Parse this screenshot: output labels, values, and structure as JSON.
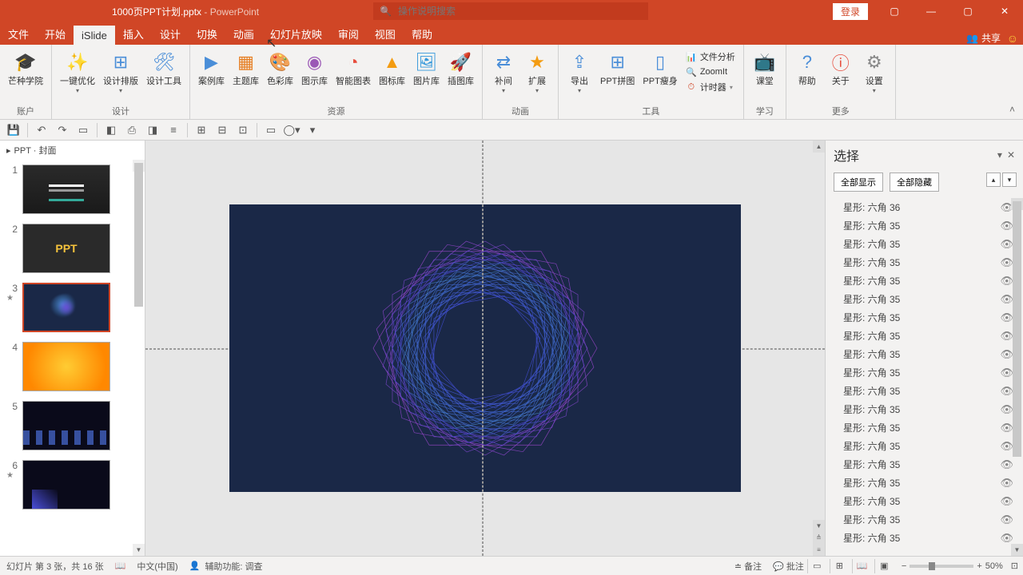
{
  "title": {
    "file": "1000页PPT计划.pptx",
    "sep": "  -  ",
    "app": "PowerPoint"
  },
  "search": {
    "placeholder": "操作说明搜索"
  },
  "login": "登录",
  "tabs": [
    "文件",
    "开始",
    "iSlide",
    "插入",
    "设计",
    "切换",
    "动画",
    "幻灯片放映",
    "审阅",
    "视图",
    "帮助"
  ],
  "active_tab": 2,
  "share": "共享",
  "ribbon": {
    "groups": [
      {
        "label": "账户",
        "items": [
          {
            "label": "芒种学院",
            "sub": "",
            "icon": "logo"
          }
        ]
      },
      {
        "label": "设计",
        "items": [
          {
            "label": "一键优化",
            "drop": true,
            "icon": "magic"
          },
          {
            "label": "设计排版",
            "drop": true,
            "icon": "layout"
          },
          {
            "label": "设计工具",
            "icon": "tools"
          }
        ]
      },
      {
        "label": "资源",
        "items": [
          {
            "label": "案例库",
            "icon": "play"
          },
          {
            "label": "主题库",
            "icon": "theme"
          },
          {
            "label": "色彩库",
            "icon": "palette"
          },
          {
            "label": "图示库",
            "icon": "diagram"
          },
          {
            "label": "智能图表",
            "icon": "pie"
          },
          {
            "label": "图标库",
            "icon": "shapes"
          },
          {
            "label": "图片库",
            "icon": "image"
          },
          {
            "label": "插图库",
            "icon": "rocket"
          }
        ]
      },
      {
        "label": "动画",
        "items": [
          {
            "label": "补间",
            "drop": true,
            "icon": "tween"
          },
          {
            "label": "扩展",
            "drop": true,
            "icon": "star"
          }
        ]
      },
      {
        "label": "工具",
        "items": [
          {
            "label": "导出",
            "drop": true,
            "icon": "export"
          },
          {
            "label": "PPT拼图",
            "icon": "grid"
          },
          {
            "label": "PPT瘦身",
            "icon": "slim"
          }
        ],
        "small": [
          {
            "label": "文件分析",
            "icon": "analysis",
            "color": "#d04626"
          },
          {
            "label": "ZoomIt",
            "icon": "zoom",
            "color": "#d04626"
          },
          {
            "label": "计时器",
            "icon": "timer",
            "drop": true,
            "color": "#d04626"
          }
        ]
      },
      {
        "label": "学习",
        "items": [
          {
            "label": "课堂",
            "icon": "class"
          }
        ]
      },
      {
        "label": "更多",
        "items": [
          {
            "label": "帮助",
            "icon": "help"
          },
          {
            "label": "关于",
            "icon": "about"
          },
          {
            "label": "设置",
            "drop": true,
            "icon": "gear"
          }
        ]
      }
    ]
  },
  "slidepanel": {
    "header": "PPT · 封面",
    "slides": [
      {
        "n": "1",
        "cls": "t1"
      },
      {
        "n": "2",
        "cls": "t2"
      },
      {
        "n": "3",
        "cls": "t3",
        "active": true,
        "star": true
      },
      {
        "n": "4",
        "cls": "t4"
      },
      {
        "n": "5",
        "cls": "t5"
      },
      {
        "n": "6",
        "cls": "t6",
        "star": true
      }
    ]
  },
  "selpane": {
    "title": "选择",
    "show_all": "全部显示",
    "hide_all": "全部隐藏",
    "items": [
      "星形: 六角 36",
      "星形: 六角 35",
      "星形: 六角 35",
      "星形: 六角 35",
      "星形: 六角 35",
      "星形: 六角 35",
      "星形: 六角 35",
      "星形: 六角 35",
      "星形: 六角 35",
      "星形: 六角 35",
      "星形: 六角 35",
      "星形: 六角 35",
      "星形: 六角 35",
      "星形: 六角 35",
      "星形: 六角 35",
      "星形: 六角 35",
      "星形: 六角 35",
      "星形: 六角 35",
      "星形: 六角 35"
    ]
  },
  "status": {
    "slide": "幻灯片 第 3 张，共 16 张",
    "lang": "中文(中国)",
    "access": "辅助功能: 调查",
    "notes": "备注",
    "comments": "批注",
    "zoom": "50%"
  }
}
